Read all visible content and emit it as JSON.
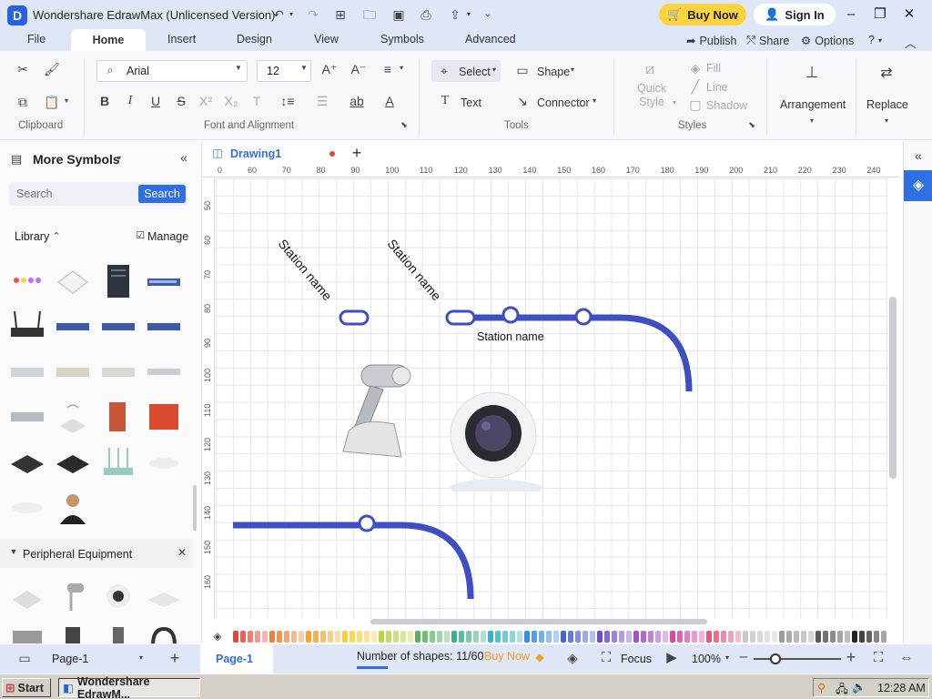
{
  "titlebar": {
    "title": "Wondershare EdrawMax (Unlicensed Version)",
    "buy_now": "Buy Now",
    "sign_in": "Sign In"
  },
  "tabs": [
    {
      "label": "File"
    },
    {
      "label": "Home"
    },
    {
      "label": "Insert"
    },
    {
      "label": "Design"
    },
    {
      "label": "View"
    },
    {
      "label": "Symbols"
    },
    {
      "label": "Advanced"
    }
  ],
  "tab_right": {
    "publish": "Publish",
    "share": "Share",
    "options": "Options"
  },
  "ribbon": {
    "clipboard_label": "Clipboard",
    "font_value": "Arial",
    "font_size": "12",
    "font_align_label": "Font and Alignment",
    "select": "Select",
    "shape": "Shape",
    "text": "Text",
    "connector": "Connector",
    "tools_label": "Tools",
    "quick_style": "Quick Style",
    "fill": "Fill",
    "line": "Line",
    "shadow": "Shadow",
    "styles_label": "Styles",
    "arrangement": "Arrangement",
    "replace": "Replace"
  },
  "leftpanel": {
    "title": "More Symbols",
    "search_placeholder": "Search",
    "search_button": "Search",
    "library": "Library",
    "manage": "Manage",
    "peripheral": "Peripheral Equipment"
  },
  "document": {
    "tab_name": "Drawing1"
  },
  "ruler": {
    "h": [
      "0",
      "60",
      "70",
      "80",
      "90",
      "100",
      "110",
      "120",
      "130",
      "140",
      "150",
      "160",
      "170",
      "180",
      "190",
      "200",
      "210",
      "220",
      "230",
      "240"
    ],
    "v": [
      "50",
      "60",
      "70",
      "80",
      "90",
      "100",
      "110",
      "120",
      "130",
      "140",
      "150",
      "160"
    ]
  },
  "canvas": {
    "station_label_1": "Station name",
    "station_label_2": "Station name",
    "station_label_3": "Station name",
    "metro_color": "#3d4fc2"
  },
  "statusbar": {
    "page_select": "Page-1",
    "page_tab": "Page-1",
    "shapes_count": "Number of shapes: 11/60",
    "buy_now": "Buy Now",
    "focus": "Focus",
    "zoom": "100%"
  },
  "taskbar": {
    "start": "Start",
    "task": "Wondershare EdrawM...",
    "clock": "12:28 AM"
  },
  "palette": [
    "#e0483c",
    "#e8843a",
    "#f0a432",
    "#f5d03c",
    "#b9d34a",
    "#59b35c",
    "#3fae8f",
    "#36b3c0",
    "#3b8de0",
    "#4a62d8",
    "#6b4fcf",
    "#a450c9",
    "#d44aa2",
    "#e05b7d",
    "#c9c9c9",
    "#9b9b9b",
    "#5a5a5a",
    "#222222"
  ]
}
